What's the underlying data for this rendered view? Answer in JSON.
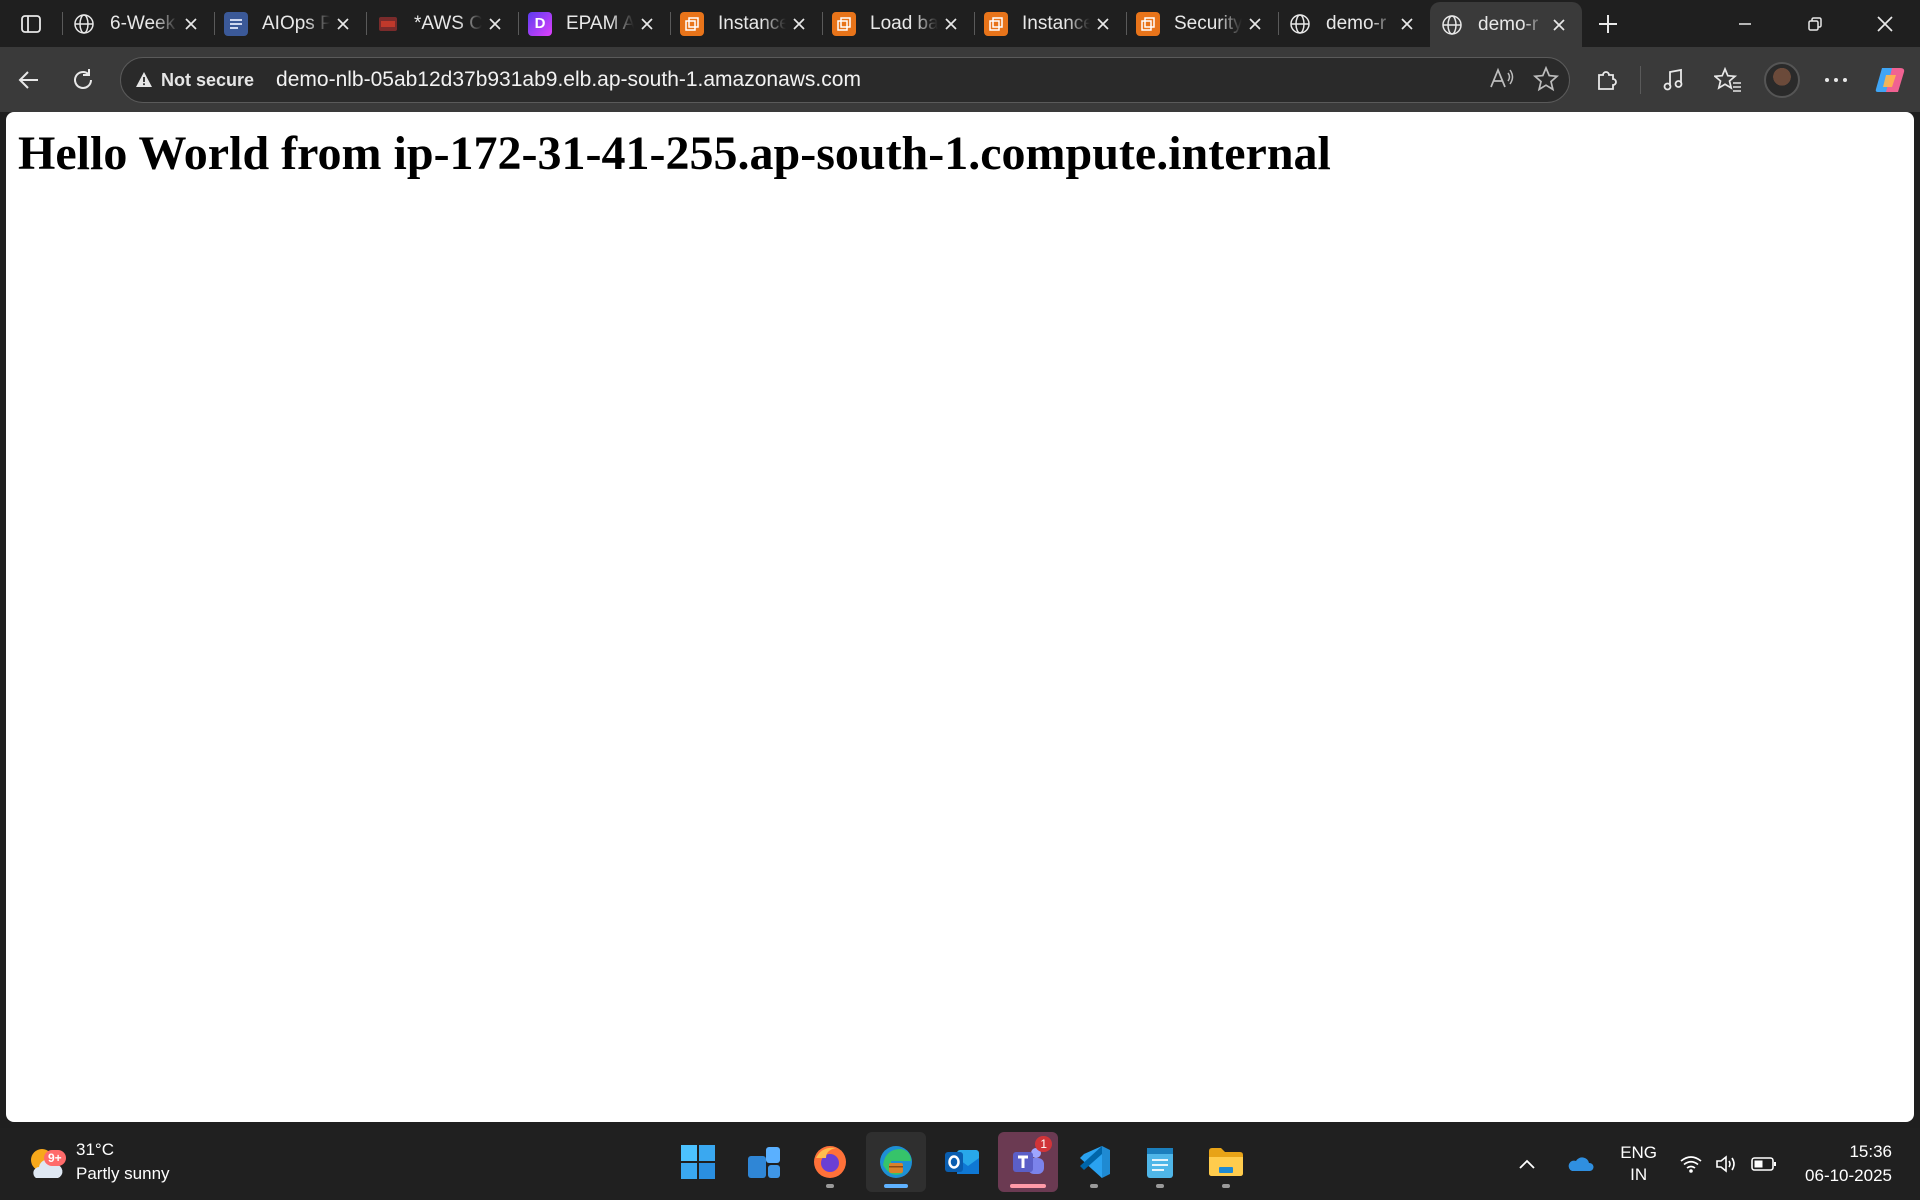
{
  "browser": {
    "tabs": [
      {
        "label": "6-Week",
        "icon": "globe-icon",
        "color": "#e8e8e8"
      },
      {
        "label": "AIOps P",
        "icon": "docs-icon",
        "color": "#4a6fd1"
      },
      {
        "label": "*AWS C",
        "icon": "pdf-icon",
        "color": "#c0392b"
      },
      {
        "label": "EPAM A",
        "icon": "epam-d-icon",
        "color": "#8a2be2"
      },
      {
        "label": "Instance",
        "icon": "aws-console-icon",
        "color": "#e8741a"
      },
      {
        "label": "Load ba",
        "icon": "aws-console-icon",
        "color": "#e8741a"
      },
      {
        "label": "Instance",
        "icon": "aws-console-icon",
        "color": "#e8741a"
      },
      {
        "label": "Security",
        "icon": "aws-console-icon",
        "color": "#e8741a"
      },
      {
        "label": "demo-r",
        "icon": "globe-icon",
        "color": "#e8e8e8"
      },
      {
        "label": "demo-r",
        "icon": "globe-icon",
        "color": "#e8e8e8",
        "active": true
      }
    ],
    "epam_glyph": "D",
    "security_label": "Not secure",
    "url": "demo-nlb-05ab12d37b931ab9.elb.ap-south-1.amazonaws.com"
  },
  "page": {
    "heading": "Hello World from ip-172-31-41-255.ap-south-1.compute.internal"
  },
  "taskbar": {
    "weather": {
      "badge": "9+",
      "temperature": "31°C",
      "condition": "Partly sunny"
    },
    "apps": [
      "start-icon",
      "widgets-icon",
      "firefox-icon",
      "edge-icon",
      "outlook-icon",
      "teams-icon",
      "vscode-icon",
      "notepad-icon",
      "file-explorer-icon"
    ],
    "teams_badge": "1",
    "language": {
      "line1": "ENG",
      "line2": "IN"
    },
    "clock": {
      "time": "15:36",
      "date": "06-10-2025"
    }
  },
  "colors": {
    "accent": "#5fb2ff",
    "aws_orange": "#e8741a",
    "teams": "#6b3a52"
  }
}
